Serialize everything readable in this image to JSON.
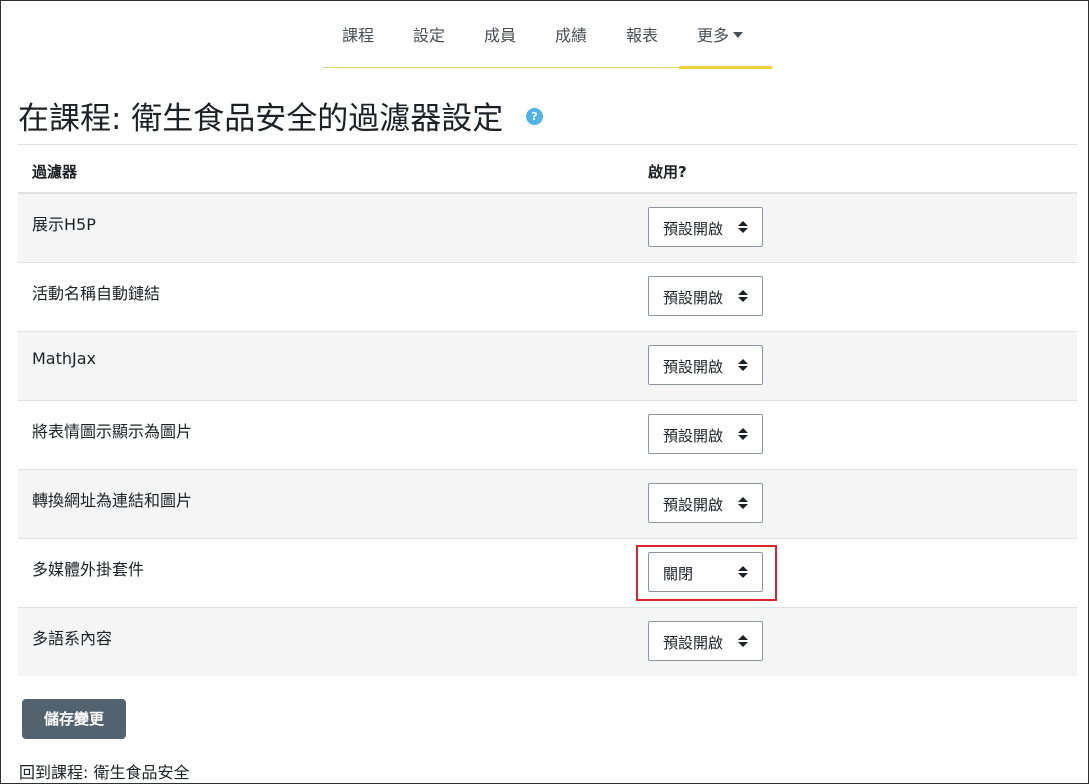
{
  "nav": {
    "items": [
      {
        "label": "課程"
      },
      {
        "label": "設定"
      },
      {
        "label": "成員"
      },
      {
        "label": "成績"
      },
      {
        "label": "報表"
      },
      {
        "label": "更多",
        "active": true
      }
    ],
    "accent_color": "#f4d13b"
  },
  "page": {
    "title": "在課程: 衛生食品安全的過濾器設定",
    "help_icon": "question-circle-icon",
    "help_glyph": "?"
  },
  "table": {
    "headers": {
      "filter": "過濾器",
      "enabled": "啟用?"
    },
    "rows": [
      {
        "name": "展示H5P",
        "value": "預設開啟"
      },
      {
        "name": "活動名稱自動鏈結",
        "value": "預設開啟"
      },
      {
        "name": "MathJax",
        "value": "預設開啟"
      },
      {
        "name": "將表情圖示顯示為圖片",
        "value": "預設開啟"
      },
      {
        "name": "轉換網址為連結和圖片",
        "value": "預設開啟"
      },
      {
        "name": "多媒體外掛套件",
        "value": "關閉",
        "highlighted": true
      },
      {
        "name": "多語系內容",
        "value": "預設開啟"
      }
    ]
  },
  "actions": {
    "save_label": "儲存變更",
    "back_link": "回到課程: 衛生食品安全"
  }
}
